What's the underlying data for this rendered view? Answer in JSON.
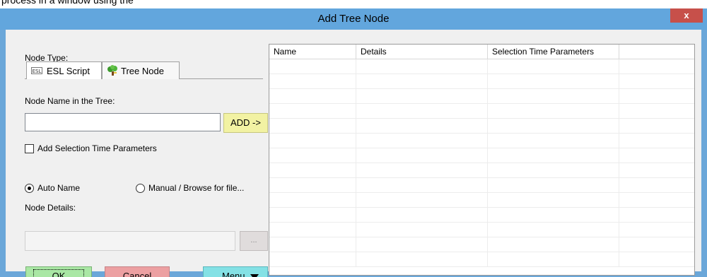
{
  "top_bleed_text": "process in a window using the",
  "window": {
    "title": "Add Tree Node",
    "close_label": "x"
  },
  "left_panel": {
    "node_type_label": "Node Type:",
    "tabs": [
      {
        "label": "ESL Script",
        "icon": "esl-icon",
        "icon_text": "ESL",
        "selected": true
      },
      {
        "label": "Tree Node",
        "icon": "tree-icon",
        "selected": false
      }
    ],
    "node_name_label": "Node Name in the Tree:",
    "node_name_value": "",
    "add_button_label": "ADD ->",
    "add_selection_params_label": "Add Selection Time Parameters",
    "add_selection_params_checked": false,
    "radio_auto_label": "Auto Name",
    "radio_manual_label": "Manual / Browse for file...",
    "selected_mode": "auto",
    "node_details_label": "Node Details:",
    "node_details_value": "",
    "browse_button_label": "...",
    "ok_label": "OK",
    "cancel_label": "Cancel",
    "menu_label": "Menu"
  },
  "grid": {
    "columns": [
      "Name",
      "Details",
      "Selection Time Parameters",
      ""
    ],
    "rows": [
      [
        "",
        "",
        "",
        ""
      ],
      [
        "",
        "",
        "",
        ""
      ],
      [
        "",
        "",
        "",
        ""
      ],
      [
        "",
        "",
        "",
        ""
      ],
      [
        "",
        "",
        "",
        ""
      ],
      [
        "",
        "",
        "",
        ""
      ],
      [
        "",
        "",
        "",
        ""
      ],
      [
        "",
        "",
        "",
        ""
      ],
      [
        "",
        "",
        "",
        ""
      ],
      [
        "",
        "",
        "",
        ""
      ],
      [
        "",
        "",
        "",
        ""
      ],
      [
        "",
        "",
        "",
        ""
      ],
      [
        "",
        "",
        "",
        ""
      ],
      [
        "",
        "",
        "",
        ""
      ]
    ]
  },
  "colors": {
    "title_bar": "#62a6dd",
    "close_button": "#c7504a",
    "add_button": "#f2f2a3",
    "ok_button": "#a9e7a4",
    "cancel_button": "#eca0a2",
    "menu_button": "#84e1e5"
  }
}
